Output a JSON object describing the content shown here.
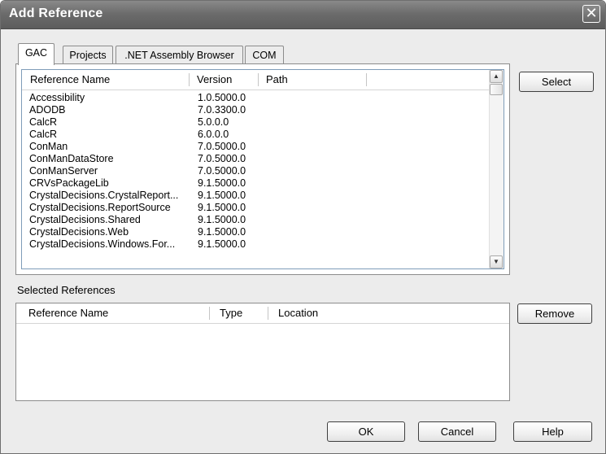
{
  "window": {
    "title": "Add Reference"
  },
  "tabs": [
    {
      "label": "GAC",
      "active": true
    },
    {
      "label": "Projects",
      "active": false
    },
    {
      "label": ".NET Assembly Browser",
      "active": false
    },
    {
      "label": "COM",
      "active": false
    }
  ],
  "gac_list": {
    "columns": [
      "Reference Name",
      "Version",
      "Path"
    ],
    "rows": [
      {
        "name": "Accessibility",
        "version": "1.0.5000.0"
      },
      {
        "name": "ADODB",
        "version": "7.0.3300.0"
      },
      {
        "name": "CalcR",
        "version": "5.0.0.0"
      },
      {
        "name": "CalcR",
        "version": "6.0.0.0"
      },
      {
        "name": "ConMan",
        "version": "7.0.5000.0"
      },
      {
        "name": "ConManDataStore",
        "version": "7.0.5000.0"
      },
      {
        "name": "ConManServer",
        "version": "7.0.5000.0"
      },
      {
        "name": "CRVsPackageLib",
        "version": "9.1.5000.0"
      },
      {
        "name": "CrystalDecisions.CrystalReport...",
        "version": "9.1.5000.0"
      },
      {
        "name": "CrystalDecisions.ReportSource",
        "version": "9.1.5000.0"
      },
      {
        "name": "CrystalDecisions.Shared",
        "version": "9.1.5000.0"
      },
      {
        "name": "CrystalDecisions.Web",
        "version": "9.1.5000.0"
      },
      {
        "name": "CrystalDecisions.Windows.For...",
        "version": "9.1.5000.0"
      }
    ]
  },
  "selected_references": {
    "label": "Selected References",
    "columns": [
      "Reference Name",
      "Type",
      "Location"
    ]
  },
  "buttons": {
    "select": "Select",
    "remove": "Remove",
    "ok": "OK",
    "cancel": "Cancel",
    "help": "Help"
  },
  "icons": {
    "close": "close-icon",
    "scroll_up": "scroll-up-icon",
    "scroll_down": "scroll-down-icon"
  }
}
